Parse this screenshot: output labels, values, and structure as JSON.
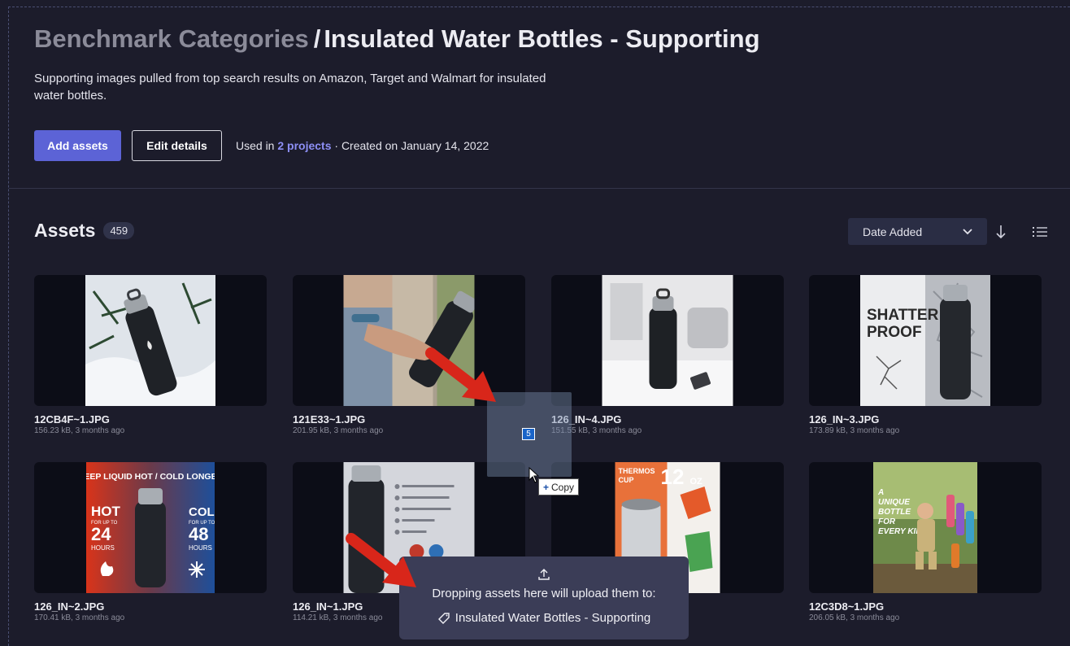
{
  "header": {
    "breadcrumb_parent": "Benchmark Categories",
    "separator": "/",
    "title": "Insulated Water Bottles - Supporting",
    "description": "Supporting images pulled from top search results on Amazon, Target and Walmart for insulated water bottles."
  },
  "actions": {
    "add_assets": "Add assets",
    "edit_details": "Edit details",
    "used_in_prefix": "Used in",
    "projects_link": "2 projects",
    "created": "· Created on January 14, 2022"
  },
  "assets": {
    "title": "Assets",
    "count": "459",
    "sort_label": "Date Added",
    "items": [
      {
        "name": "12CB4F~1.JPG",
        "meta": "156.23 kB, 3 months ago"
      },
      {
        "name": "121E33~1.JPG",
        "meta": "201.95 kB, 3 months ago"
      },
      {
        "name": "126_IN~4.JPG",
        "meta": "151.55 kB, 3 months ago"
      },
      {
        "name": "126_IN~3.JPG",
        "meta": "173.89 kB, 3 months ago"
      },
      {
        "name": "126_IN~2.JPG",
        "meta": "170.41 kB, 3 months ago"
      },
      {
        "name": "126_IN~1.JPG",
        "meta": "114.21 kB, 3 months ago"
      },
      {
        "name": "",
        "meta": ""
      },
      {
        "name": "12C3D8~1.JPG",
        "meta": "206.05 kB, 3 months ago"
      }
    ],
    "image_text": {
      "shatter": "SHATTER",
      "proof": "PROOF",
      "keep_liquid": "KEEP LIQUID HOT / COLD LONGER",
      "hot": "HOT",
      "cold": "COLD",
      "for_up_to": "FOR UP TO",
      "hours_24": "24",
      "hours_48": "48",
      "hours": "HOURS",
      "thermos": "THERMOS",
      "cup": "CUP",
      "oz": "12",
      "oz_unit": "OZ",
      "unique1": "A",
      "unique2": "UNIQUE",
      "unique3": "BOTTLE",
      "unique4": "FOR",
      "unique5": "EVERY KID"
    }
  },
  "drag": {
    "count": "5",
    "copy_label": "Copy"
  },
  "drop_panel": {
    "message": "Dropping assets here will upload them to:",
    "target": "Insulated Water Bottles - Supporting"
  },
  "colors": {
    "background": "#1c1c2b",
    "accent": "#5c63d6",
    "link": "#8d8ff5",
    "annotation_arrow": "#d8261a"
  }
}
